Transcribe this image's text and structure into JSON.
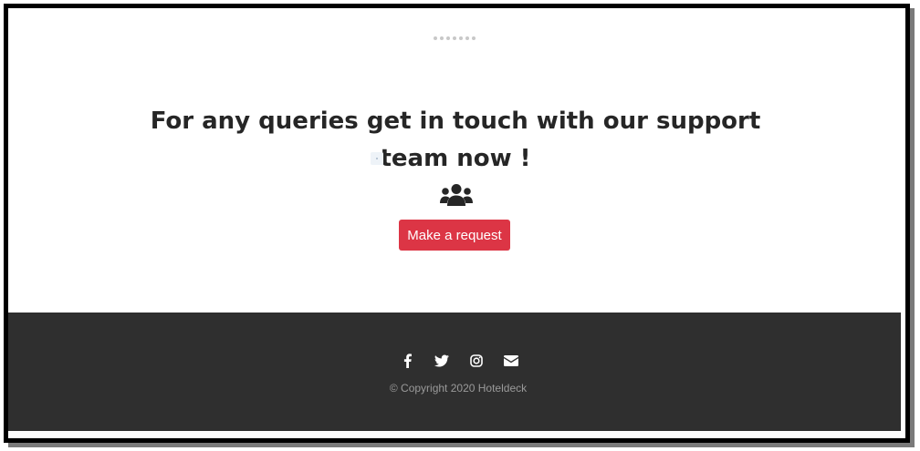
{
  "loader": {
    "dot_count": 7
  },
  "support": {
    "headline_line1": "For any queries get in touch with our support",
    "headline_line2": "team now !",
    "icon": "users-icon",
    "button_label": "Make a request",
    "button_color": "#dc3545"
  },
  "footer": {
    "background": "#2f2f2f",
    "social_icons": [
      "facebook-icon",
      "twitter-icon",
      "instagram-icon",
      "envelope-icon"
    ],
    "copyright": "© Copyright 2020 Hoteldeck"
  }
}
